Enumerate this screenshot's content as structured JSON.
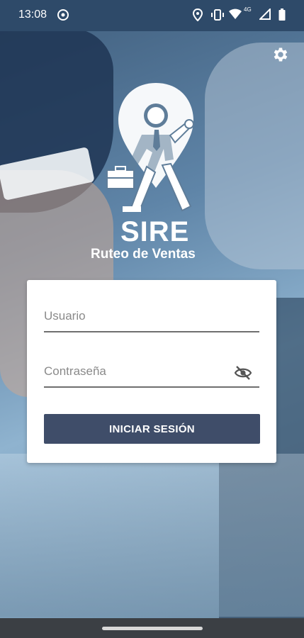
{
  "status_bar": {
    "time": "13:08",
    "network": "4G",
    "icons": [
      "sync-icon",
      "location-icon",
      "vibrate-icon",
      "wifi-icon",
      "signal-icon",
      "battery-icon"
    ]
  },
  "brand": {
    "name": "SIRE",
    "subtitle": "Ruteo de Ventas"
  },
  "login": {
    "user_placeholder": "Usuario",
    "user_value": "",
    "password_placeholder": "Contraseña",
    "password_value": "",
    "submit_label": "INICIAR SESIÓN"
  },
  "colors": {
    "status_bar": "#2e4a69",
    "button": "#3f4d69",
    "card": "#ffffff"
  }
}
